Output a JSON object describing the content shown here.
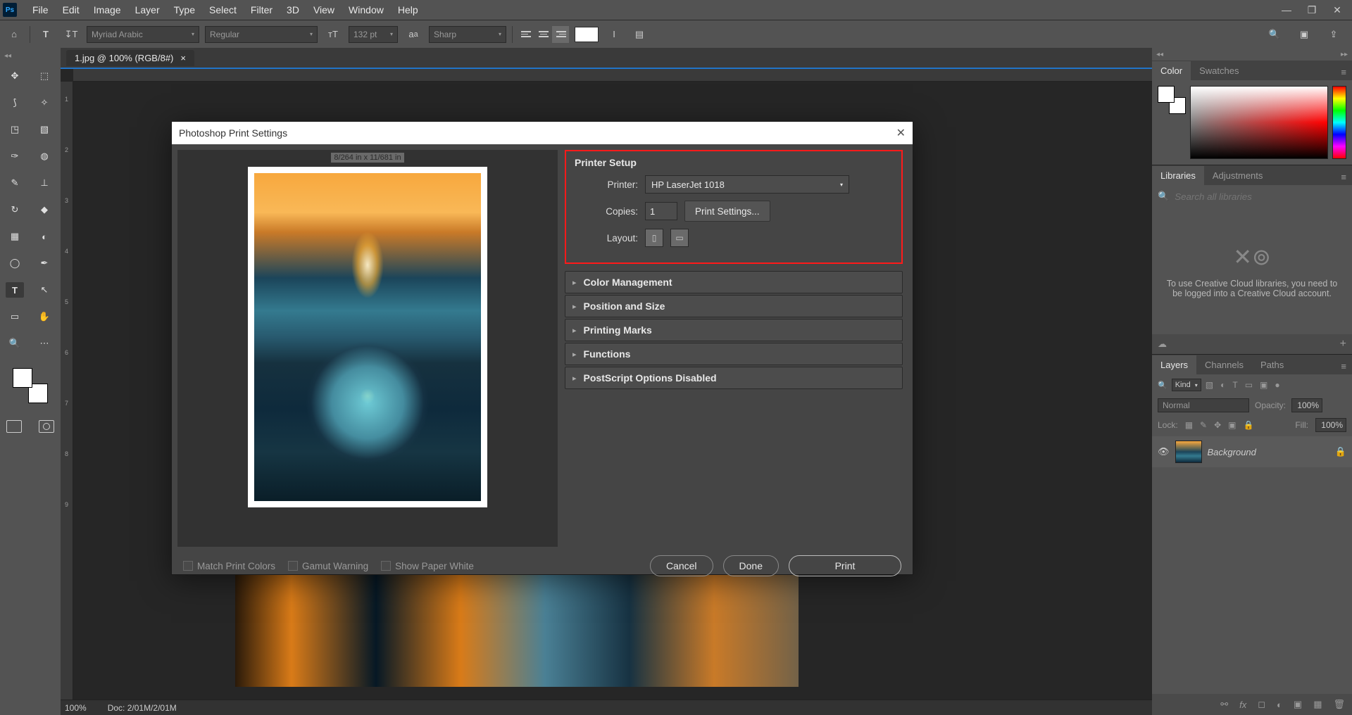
{
  "menu": {
    "items": [
      "File",
      "Edit",
      "Image",
      "Layer",
      "Type",
      "Select",
      "Filter",
      "3D",
      "View",
      "Window",
      "Help"
    ]
  },
  "optbar": {
    "font": "Myriad Arabic",
    "weight": "Regular",
    "size": "132 pt",
    "aa": "Sharp"
  },
  "doc": {
    "tab": "1.jpg @ 100% (RGB/8#)",
    "zoom": "100%",
    "status": "Doc: 2/01M/2/01M"
  },
  "ruler": {
    "marks": [
      "1",
      "2",
      "3",
      "4",
      "5",
      "6",
      "7",
      "8",
      "9"
    ]
  },
  "tools": {
    "t": [
      [
        "↔",
        "⬚"
      ],
      [
        "↗",
        "✦"
      ],
      [
        "✂",
        "▧"
      ],
      [
        "◢",
        "☰"
      ],
      [
        "⚗",
        "◐"
      ],
      [
        "✎",
        "⊥"
      ],
      [
        "✐",
        "◆"
      ],
      [
        "▥",
        "◑"
      ],
      [
        "◒",
        "✒"
      ],
      [
        "T",
        "↖"
      ],
      [
        "✋",
        "✋"
      ],
      [
        "🔍",
        "⋯"
      ]
    ]
  },
  "panels": {
    "color": {
      "tab1": "Color",
      "tab2": "Swatches"
    },
    "lib": {
      "tab1": "Libraries",
      "tab2": "Adjustments",
      "search": "Search all libraries",
      "msg": "To use Creative Cloud libraries, you need to be logged into a Creative Cloud account."
    },
    "layers": {
      "tab1": "Layers",
      "tab2": "Channels",
      "tab3": "Paths",
      "kind": "Kind",
      "mode": "Normal",
      "opacity_label": "Opacity:",
      "opacity": "100%",
      "lock": "Lock:",
      "fill_label": "Fill:",
      "fill": "100%",
      "bg_layer": "Background"
    }
  },
  "dialog": {
    "title": "Photoshop Print Settings",
    "preview_dim": "8/264 in x 11/681 in",
    "printer_setup": "Printer Setup",
    "printer_label": "Printer:",
    "printer": "HP LaserJet 1018",
    "copies_label": "Copies:",
    "copies": "1",
    "settings_btn": "Print Settings...",
    "layout_label": "Layout:",
    "sections": [
      "Color Management",
      "Position and Size",
      "Printing Marks",
      "Functions",
      "PostScript Options Disabled"
    ],
    "checks": [
      "Match Print Colors",
      "Gamut Warning",
      "Show Paper White"
    ],
    "cancel": "Cancel",
    "done": "Done",
    "print": "Print"
  }
}
